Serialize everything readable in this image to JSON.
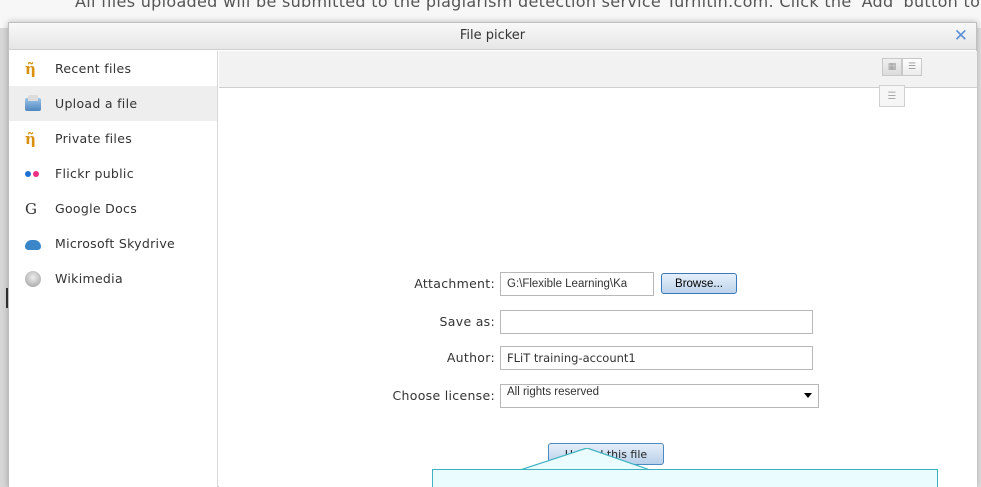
{
  "background": {
    "banner_text": "All files uploaded will be submitted to the plagiarism detection service Turnitin.com. Click the 'Add' button to"
  },
  "dialog": {
    "title": "File picker",
    "close_glyph": "✕"
  },
  "sidebar": {
    "items": [
      {
        "label": "Recent files",
        "icon": "moodle-icon",
        "active": false
      },
      {
        "label": "Upload a file",
        "icon": "upload-icon",
        "active": true
      },
      {
        "label": "Private files",
        "icon": "moodle-icon",
        "active": false
      },
      {
        "label": "Flickr public",
        "icon": "flickr-icon",
        "active": false
      },
      {
        "label": "Google Docs",
        "icon": "google-docs-icon",
        "active": false
      },
      {
        "label": "Microsoft Skydrive",
        "icon": "skydrive-icon",
        "active": false
      },
      {
        "label": "Wikimedia",
        "icon": "wikimedia-icon",
        "active": false
      }
    ]
  },
  "form": {
    "attachment_label": "Attachment:",
    "attachment_value": "G:\\Flexible Learning\\Ka",
    "browse_label": "Browse...",
    "save_as_label": "Save as:",
    "save_as_value": "",
    "author_label": "Author:",
    "author_value": "FLiT training-account1",
    "license_label": "Choose license:",
    "license_value": "All rights reserved",
    "upload_label": "Upload this file"
  },
  "colors": {
    "accent": "#5b8fd6",
    "callout_border": "#3fb2c2",
    "callout_fill": "#eafcfe"
  }
}
